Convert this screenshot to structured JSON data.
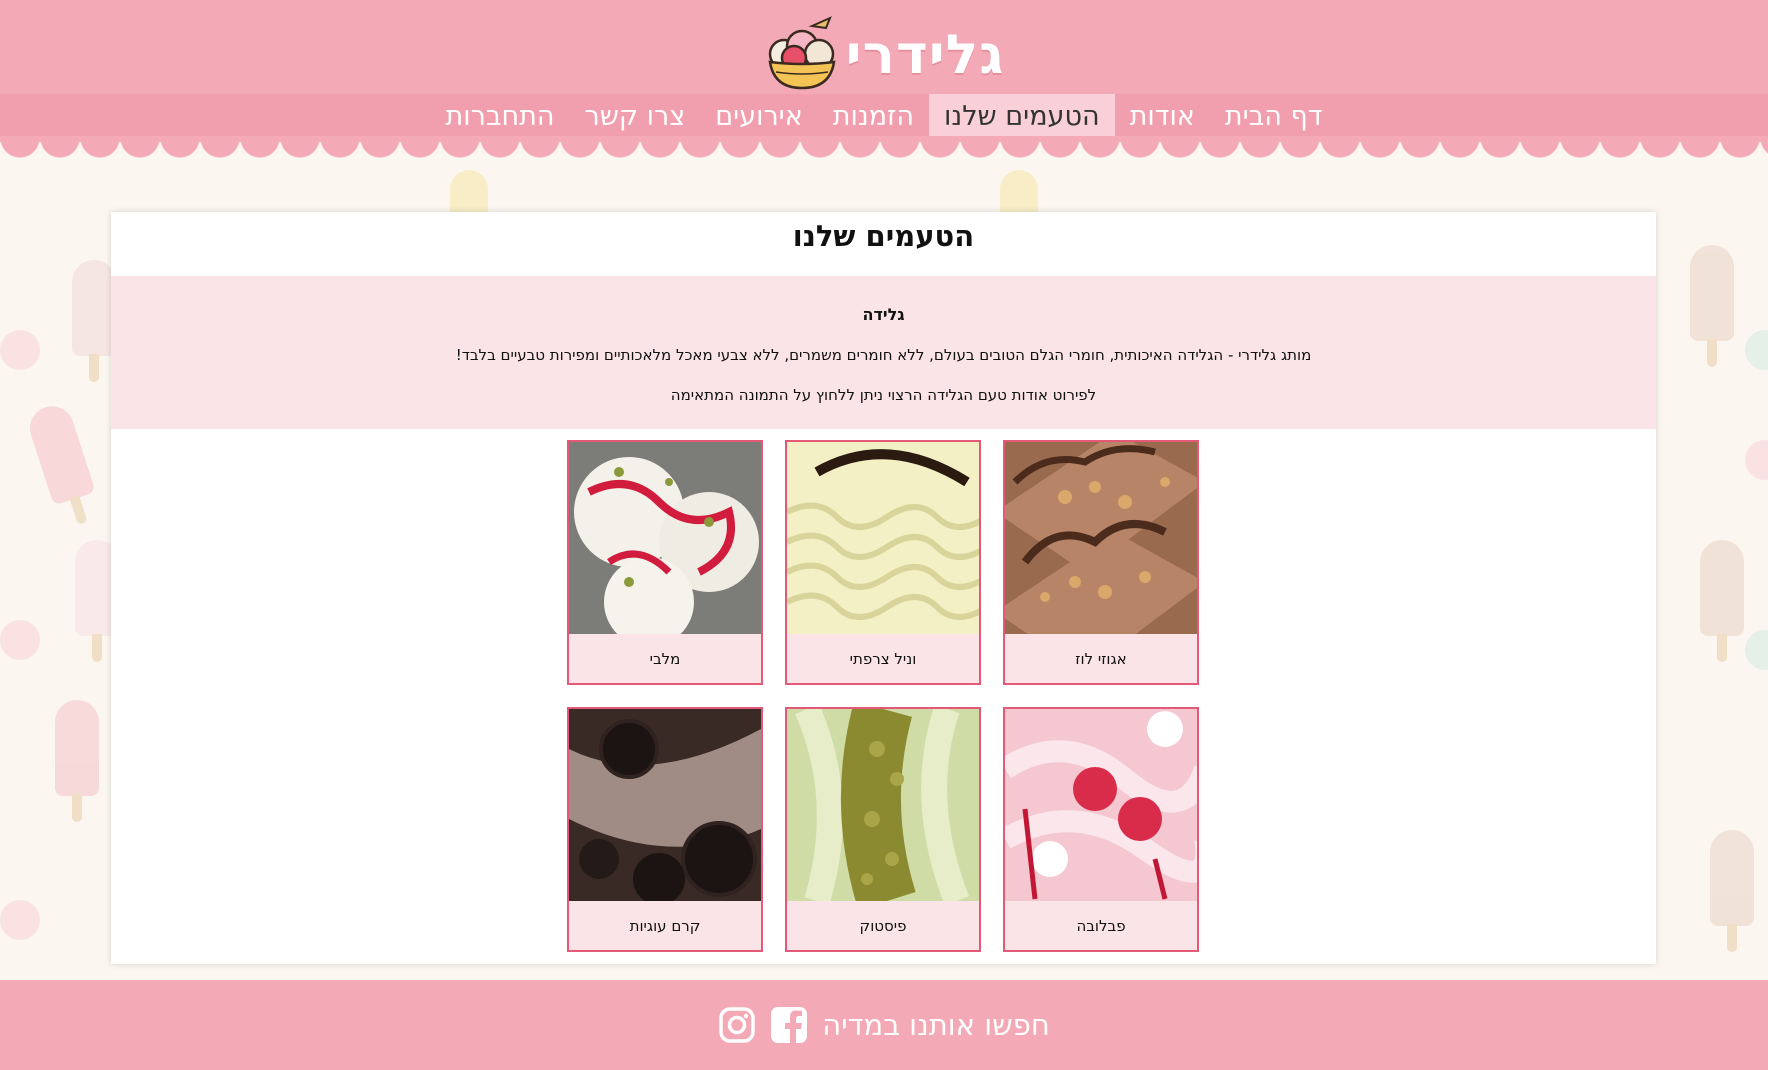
{
  "brand": {
    "name": "גלידרי",
    "logo_icon": "ice-cream-bowl-icon"
  },
  "nav": {
    "items": [
      {
        "label": "דף הבית",
        "active": false
      },
      {
        "label": "אודות",
        "active": false
      },
      {
        "label": "הטעמים שלנו",
        "active": true
      },
      {
        "label": "הזמנות",
        "active": false
      },
      {
        "label": "אירועים",
        "active": false
      },
      {
        "label": "צרו קשר",
        "active": false
      },
      {
        "label": "התחברות",
        "active": false
      }
    ]
  },
  "main": {
    "title": "הטעמים שלנו",
    "intro": {
      "heading": "גלידה",
      "text": "מותג גלידרי - הגלידה האיכותית, חומרי הגלם הטובים בעולם, ללא חומרים משמרים, ללא צבעי מאכל מלאכותיים ומפירות טבעיים בלבד!",
      "hint": "לפירוט אודות טעם הגלידה הרצוי ניתן ללחוץ על התמונה המתאימה"
    },
    "flavors": [
      {
        "label": "אגוזי לוז"
      },
      {
        "label": "וניל צרפתי"
      },
      {
        "label": "מלבי"
      },
      {
        "label": "פבלובה"
      },
      {
        "label": "פיסטוק"
      },
      {
        "label": "קרם עוגיות"
      }
    ]
  },
  "footer": {
    "text": "חפשו אותנו במדיה",
    "icons": [
      "facebook-icon",
      "instagram-icon"
    ]
  },
  "colors": {
    "header": "#f4aab6",
    "nav": "#f19fae",
    "accent_border": "#e25a78",
    "panel_tint": "#fae4e8"
  }
}
